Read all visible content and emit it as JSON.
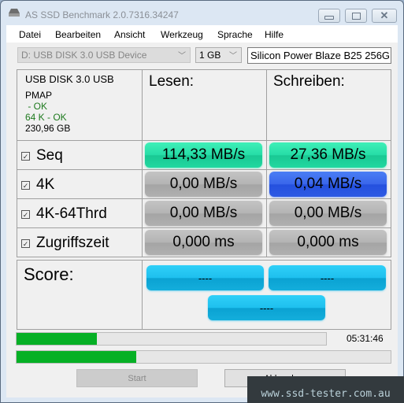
{
  "window": {
    "title": "AS SSD Benchmark 2.0.7316.34247",
    "minimize_icon": "minimize-icon",
    "maximize_icon": "restore-icon",
    "close_icon": "close-icon"
  },
  "menu": [
    "Datei",
    "Bearbeiten",
    "Ansicht",
    "Werkzeug",
    "Sprache",
    "Hilfe"
  ],
  "toolbar": {
    "drive": "D: USB DISK 3.0 USB Device",
    "size": "1 GB",
    "name_value": "Silicon Power Blaze B25 256G"
  },
  "info": {
    "device": "USB DISK 3.0 USB",
    "partition": "PMAP",
    "status1": " - OK",
    "status2": "64 K - OK",
    "capacity": "230,96 GB"
  },
  "headers": {
    "read": "Lesen:",
    "write": "Schreiben:"
  },
  "rows": [
    {
      "label": "Seq",
      "checked": true,
      "read": "114,33 MB/s",
      "write": "27,36 MB/s"
    },
    {
      "label": "4K",
      "checked": true,
      "read": "0,00 MB/s",
      "write": "0,04 MB/s"
    },
    {
      "label": "4K-64Thrd",
      "checked": true,
      "read": "0,00 MB/s",
      "write": "0,00 MB/s"
    },
    {
      "label": "Zugriffszeit",
      "checked": true,
      "read": "0,000 ms",
      "write": "0,000 ms"
    }
  ],
  "score": {
    "label": "Score:",
    "read": "----",
    "write": "----",
    "total": "----"
  },
  "progress": {
    "top_percent": 26,
    "bottom_percent": 32,
    "time": "05:31:46"
  },
  "buttons": {
    "start": "Start",
    "cancel": "Abbrechen"
  },
  "watermark": "www.ssd-tester.com.au",
  "colors": {
    "green": "#26dca6",
    "gray": "#b4b4b4",
    "blue": "#3a66ea",
    "cyan": "#1ec0ee",
    "progress": "#06b025"
  }
}
